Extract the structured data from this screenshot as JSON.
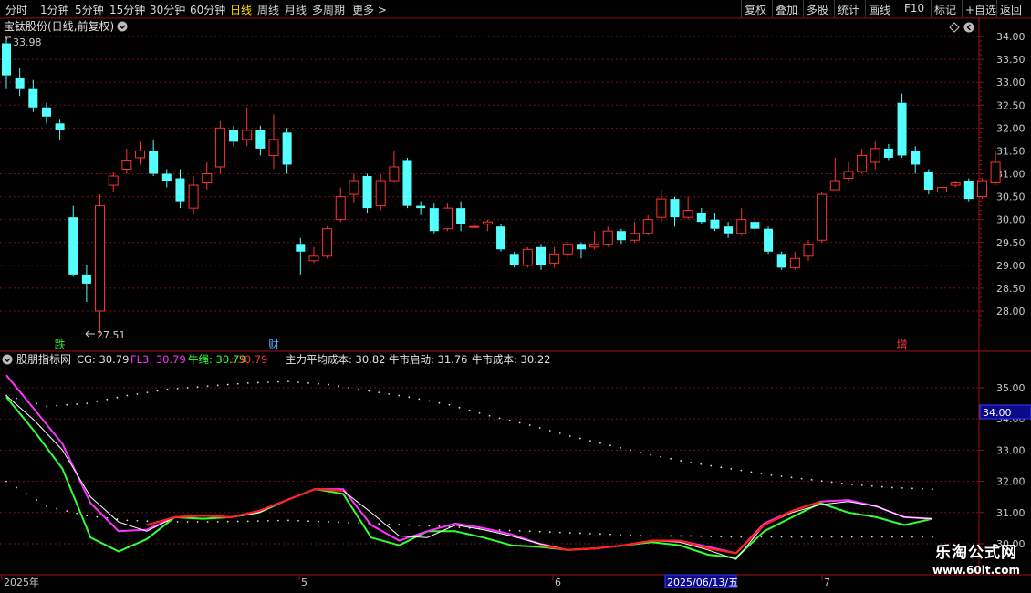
{
  "toolbar": {
    "left_items": [
      "分时",
      "1分钟",
      "5分钟",
      "15分钟",
      "30分钟",
      "60分钟",
      "日线",
      "周线",
      "月线",
      "多周期",
      "更多 >"
    ],
    "active_item": "日线",
    "right_items": [
      "复权",
      "叠加",
      "多股",
      "统计",
      "画线",
      "F10",
      "标记",
      "+自选",
      "返回"
    ]
  },
  "main_chart": {
    "title": "宝钛股份(日线,前复权)",
    "high_label": "33.98",
    "low_label": "27.51",
    "y_ticks": [
      "34.00",
      "33.50",
      "33.00",
      "32.50",
      "32.00",
      "31.50",
      "31.00",
      "30.50",
      "30.00",
      "29.50",
      "29.00",
      "28.50",
      "28.00"
    ],
    "markers": [
      {
        "text": "跌",
        "color": "#35e235",
        "index": 4
      },
      {
        "text": "财",
        "color": "#5ea7ff",
        "index": 20
      },
      {
        "text": "增",
        "color": "#ff3b3b",
        "index": 67
      }
    ]
  },
  "indicator": {
    "name": "股朋指标网",
    "legend": [
      {
        "text": "CG: 30.79",
        "color": "#e0e0e0"
      },
      {
        "text": "FL3: 30.79",
        "color": "#ff33ff"
      },
      {
        "text": "牛绳: 30.79",
        "color": "#33ff33"
      },
      {
        "text": ": 30.79",
        "color": "#ff3333"
      },
      {
        "text": "主力平均成本: 30.82",
        "color": "#e0e0e0"
      },
      {
        "text": "牛市启动: 31.76",
        "color": "#e0e0e0"
      },
      {
        "text": "牛市成本: 30.22",
        "color": "#e0e0e0"
      }
    ],
    "y_ticks": [
      "35.00",
      "34.00",
      "33.00",
      "32.00",
      "31.00",
      "30.00"
    ],
    "cursor_value": "34.00"
  },
  "time_axis": {
    "labels": [
      "2025年",
      "5",
      "6",
      "7"
    ],
    "cursor_date": "2025/06/13/五"
  },
  "watermark": {
    "line1": "乐淘公式网",
    "line2": "www.60lt.com"
  },
  "colors": {
    "up": "#ff3232",
    "down": "#54ffff",
    "grid": "#7a1010",
    "axis_text": "#c8c8c8",
    "cg": "#ffffff",
    "fl3": "#ff33ff",
    "bull": "#33ff33",
    "red_line": "#ff2020"
  },
  "chart_data": {
    "type": "candlestick",
    "y_range": [
      27.5,
      34.2
    ],
    "candles": [
      [
        33.85,
        33.15,
        33.98,
        32.85
      ],
      [
        33.1,
        32.85,
        33.3,
        32.7
      ],
      [
        32.85,
        32.45,
        33.05,
        32.35
      ],
      [
        32.45,
        32.25,
        32.55,
        32.1
      ],
      [
        32.1,
        31.95,
        32.2,
        31.75
      ],
      [
        30.05,
        28.8,
        30.3,
        28.75
      ],
      [
        28.8,
        28.6,
        29.0,
        28.2
      ],
      [
        28.0,
        30.3,
        30.55,
        27.51
      ],
      [
        30.75,
        30.95,
        31.05,
        30.6
      ],
      [
        31.1,
        31.3,
        31.55,
        31.0
      ],
      [
        31.35,
        31.5,
        31.7,
        31.2
      ],
      [
        31.5,
        31.0,
        31.75,
        30.95
      ],
      [
        31.0,
        30.85,
        31.1,
        30.7
      ],
      [
        30.9,
        30.4,
        31.1,
        30.25
      ],
      [
        30.25,
        30.75,
        30.95,
        30.1
      ],
      [
        30.8,
        31.0,
        31.25,
        30.65
      ],
      [
        31.15,
        32.0,
        32.15,
        31.0
      ],
      [
        31.95,
        31.7,
        32.05,
        31.6
      ],
      [
        31.75,
        31.95,
        32.45,
        31.6
      ],
      [
        31.95,
        31.55,
        32.05,
        31.4
      ],
      [
        31.4,
        31.75,
        32.3,
        31.1
      ],
      [
        31.9,
        31.2,
        32.0,
        31.0
      ],
      [
        29.45,
        29.3,
        29.6,
        28.8
      ],
      [
        29.1,
        29.2,
        29.4,
        29.05
      ],
      [
        29.2,
        29.8,
        29.85,
        29.15
      ],
      [
        30.0,
        30.5,
        30.7,
        29.95
      ],
      [
        30.55,
        30.85,
        31.0,
        30.35
      ],
      [
        30.95,
        30.25,
        31.0,
        30.15
      ],
      [
        30.3,
        30.85,
        31.0,
        30.2
      ],
      [
        30.85,
        31.15,
        31.5,
        30.8
      ],
      [
        31.3,
        30.3,
        31.35,
        30.25
      ],
      [
        30.3,
        30.25,
        30.4,
        30.1
      ],
      [
        30.25,
        29.75,
        30.35,
        29.7
      ],
      [
        29.8,
        30.25,
        30.35,
        29.75
      ],
      [
        30.25,
        29.9,
        30.4,
        29.75
      ],
      [
        29.85,
        29.85,
        29.95,
        29.8
      ],
      [
        29.9,
        29.95,
        30.0,
        29.75
      ],
      [
        29.85,
        29.35,
        29.9,
        29.3
      ],
      [
        29.25,
        29.0,
        29.3,
        28.95
      ],
      [
        29.0,
        29.35,
        29.4,
        28.95
      ],
      [
        29.4,
        29.0,
        29.45,
        28.9
      ],
      [
        29.05,
        29.25,
        29.4,
        28.95
      ],
      [
        29.25,
        29.45,
        29.55,
        29.1
      ],
      [
        29.45,
        29.35,
        29.5,
        29.15
      ],
      [
        29.4,
        29.45,
        29.75,
        29.35
      ],
      [
        29.45,
        29.75,
        29.85,
        29.4
      ],
      [
        29.75,
        29.55,
        29.8,
        29.45
      ],
      [
        29.55,
        29.7,
        29.95,
        29.5
      ],
      [
        29.7,
        30.0,
        30.1,
        29.65
      ],
      [
        30.05,
        30.45,
        30.65,
        29.95
      ],
      [
        30.45,
        30.05,
        30.5,
        29.85
      ],
      [
        30.05,
        30.2,
        30.5,
        30.0
      ],
      [
        30.15,
        29.95,
        30.25,
        29.9
      ],
      [
        30.0,
        29.8,
        30.15,
        29.75
      ],
      [
        29.85,
        29.7,
        29.95,
        29.6
      ],
      [
        29.7,
        30.0,
        30.25,
        29.65
      ],
      [
        29.95,
        29.8,
        30.05,
        29.65
      ],
      [
        29.8,
        29.3,
        29.85,
        29.25
      ],
      [
        29.25,
        28.95,
        29.3,
        28.9
      ],
      [
        28.95,
        29.15,
        29.3,
        28.9
      ],
      [
        29.2,
        29.45,
        29.55,
        29.1
      ],
      [
        29.55,
        30.55,
        30.6,
        29.5
      ],
      [
        30.65,
        30.85,
        31.35,
        30.65
      ],
      [
        30.9,
        31.05,
        31.25,
        30.85
      ],
      [
        31.05,
        31.4,
        31.55,
        31.0
      ],
      [
        31.25,
        31.55,
        31.7,
        31.1
      ],
      [
        31.55,
        31.35,
        31.65,
        31.3
      ],
      [
        32.55,
        31.4,
        32.75,
        31.35
      ],
      [
        31.5,
        31.2,
        31.6,
        31.0
      ],
      [
        31.05,
        30.65,
        31.1,
        30.55
      ],
      [
        30.6,
        30.7,
        30.8,
        30.55
      ],
      [
        30.75,
        30.8,
        30.85,
        30.7
      ],
      [
        30.85,
        30.45,
        30.9,
        30.4
      ],
      [
        30.5,
        30.85,
        30.9,
        30.45
      ],
      [
        30.8,
        31.25,
        31.5,
        30.75
      ]
    ],
    "indicator_series": {
      "cg": [
        34.75,
        33.95,
        33.0,
        31.5,
        30.7,
        30.4,
        30.85,
        30.9,
        30.85,
        31.0,
        31.4,
        31.75,
        31.7,
        31.0,
        30.25,
        30.2,
        30.6,
        30.45,
        30.25,
        30.0,
        29.8,
        29.85,
        29.95,
        30.1,
        30.05,
        29.8,
        29.5,
        30.6,
        31.0,
        31.25,
        31.35,
        31.2,
        30.85,
        30.8
      ],
      "fl3": [
        35.4,
        34.3,
        33.2,
        31.3,
        30.4,
        30.45,
        30.85,
        30.9,
        30.85,
        31.05,
        31.4,
        31.75,
        31.75,
        30.6,
        30.1,
        30.4,
        30.65,
        30.5,
        30.3,
        30.0,
        29.8,
        29.85,
        29.95,
        30.1,
        30.1,
        29.9,
        29.7,
        30.65,
        31.05,
        31.35,
        31.4,
        31.2,
        30.85,
        30.8
      ],
      "bull": [
        34.7,
        33.6,
        32.4,
        30.2,
        29.75,
        30.15,
        30.85,
        30.8,
        30.85,
        31.0,
        31.4,
        31.75,
        31.6,
        30.2,
        29.95,
        30.4,
        30.4,
        30.2,
        29.95,
        29.9,
        29.8,
        29.85,
        29.95,
        30.05,
        29.95,
        29.65,
        29.55,
        30.4,
        30.85,
        31.3,
        31.0,
        30.85,
        30.6,
        30.8
      ],
      "red": [
        null,
        null,
        null,
        null,
        null,
        30.6,
        30.85,
        30.9,
        30.85,
        31.05,
        31.4,
        31.75,
        31.7,
        null,
        null,
        30.6,
        null,
        null,
        null,
        29.95,
        29.8,
        29.85,
        29.95,
        30.1,
        30.1,
        29.85,
        29.7,
        30.6,
        31.05,
        31.35,
        null,
        null,
        null,
        null
      ],
      "upper_dots": [
        34.75,
        34.4,
        34.5,
        34.75,
        34.95,
        35.05,
        35.15,
        35.2,
        35.1,
        34.9,
        34.7,
        34.45,
        34.1,
        33.8,
        33.45,
        33.15,
        32.85,
        32.6,
        32.4,
        32.2,
        32.05,
        31.9,
        31.8,
        31.75
      ],
      "lower_dots": [
        32.0,
        31.2,
        30.9,
        30.75,
        30.7,
        30.7,
        30.72,
        30.75,
        30.7,
        30.65,
        30.6,
        30.55,
        30.45,
        30.4,
        30.35,
        30.3,
        30.25,
        30.25,
        30.22,
        30.22,
        30.22,
        30.22,
        30.22,
        30.22
      ]
    }
  }
}
